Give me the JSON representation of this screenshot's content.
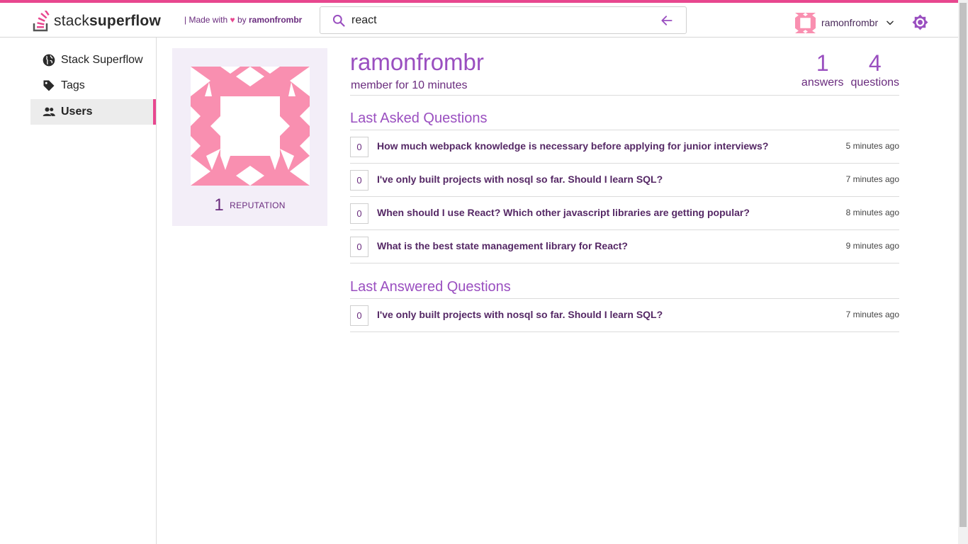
{
  "header": {
    "logo_prefix": "stack",
    "logo_suffix": "superflow",
    "made_with_prefix": "| Made with",
    "heart": "♥",
    "made_with_by": "by",
    "made_with_author": "ramonfrombr",
    "search_value": "react",
    "user_name": "ramonfrombr"
  },
  "sidebar": {
    "items": [
      {
        "label": "Stack Superflow",
        "icon": "globe-icon"
      },
      {
        "label": "Tags",
        "icon": "tag-icon"
      },
      {
        "label": "Users",
        "icon": "users-icon",
        "active": true
      }
    ]
  },
  "profile": {
    "reputation_value": "1",
    "reputation_label": "REPUTATION",
    "username": "ramonfrombr",
    "member_since": "member for 10 minutes",
    "answers_count": "1",
    "answers_label": "answers",
    "questions_count": "4",
    "questions_label": "questions"
  },
  "asked": {
    "title": "Last Asked Questions",
    "items": [
      {
        "votes": "0",
        "title": "How much webpack knowledge is necessary before applying for junior interviews?",
        "time": "5 minutes ago"
      },
      {
        "votes": "0",
        "title": "I've only built projects with nosql so far. Should I learn SQL?",
        "time": "7 minutes ago"
      },
      {
        "votes": "0",
        "title": "When should I use React? Which other javascript libraries are getting popular?",
        "time": "8 minutes ago"
      },
      {
        "votes": "0",
        "title": "What is the best state management library for React?",
        "time": "9 minutes ago"
      }
    ]
  },
  "answered": {
    "title": "Last Answered Questions",
    "items": [
      {
        "votes": "0",
        "title": "I've only built projects with nosql so far. Should I learn SQL?",
        "time": "7 minutes ago"
      }
    ]
  },
  "colors": {
    "accent": "#e8478f",
    "brand_purple": "#9a4fc0",
    "identicon_pink": "#f98fb0"
  }
}
